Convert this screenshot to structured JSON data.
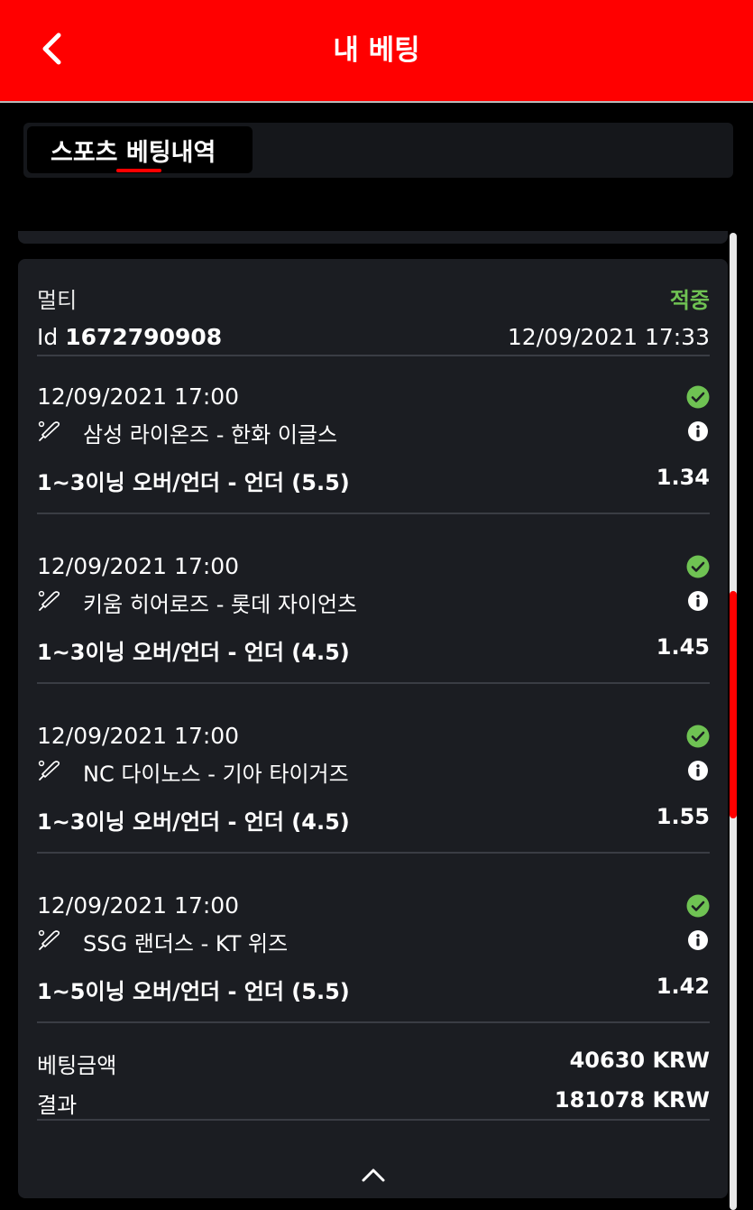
{
  "header": {
    "title": "내 베팅",
    "background": "#ff0000"
  },
  "tabs": [
    {
      "label": "스포츠 베팅내역",
      "active": true
    }
  ],
  "bet": {
    "type": "멀티",
    "status": "적중",
    "status_color": "#6fc253",
    "id_prefix": "Id",
    "id": "1672790908",
    "placed_at": "12/09/2021 17:33",
    "selections": [
      {
        "time": "12/09/2021 17:00",
        "match": "삼성 라이온즈 - 한화 이글스",
        "market": "1~3이닝 오버/언더 - 언더 (5.5)",
        "odds": "1.34",
        "result_icon": "check-circle-icon",
        "sport_icon": "baseball-bat-icon"
      },
      {
        "time": "12/09/2021 17:00",
        "match": "키움 히어로즈 - 롯데 자이언츠",
        "market": "1~3이닝 오버/언더 - 언더 (4.5)",
        "odds": "1.45",
        "result_icon": "check-circle-icon",
        "sport_icon": "baseball-bat-icon"
      },
      {
        "time": "12/09/2021 17:00",
        "match": "NC 다이노스 - 기아 타이거즈",
        "market": "1~3이닝 오버/언더 - 언더 (4.5)",
        "odds": "1.55",
        "result_icon": "check-circle-icon",
        "sport_icon": "baseball-bat-icon"
      },
      {
        "time": "12/09/2021 17:00",
        "match": "SSG 랜더스 - KT 위즈",
        "market": "1~5이닝 오버/언더 - 언더 (5.5)",
        "odds": "1.42",
        "result_icon": "check-circle-icon",
        "sport_icon": "baseball-bat-icon"
      }
    ],
    "summary": {
      "stake_label": "베팅금액",
      "stake_value": "40630 KRW",
      "result_label": "결과",
      "result_value": "181078 KRW"
    }
  }
}
